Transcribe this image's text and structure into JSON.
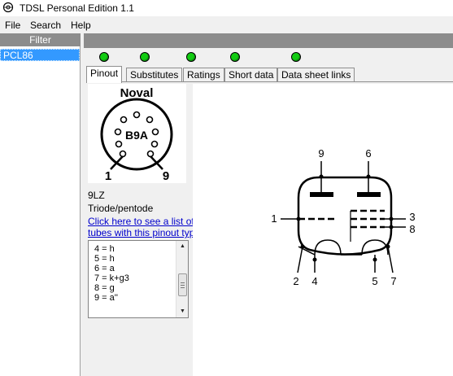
{
  "window": {
    "title": "TDSL Personal Edition 1.1"
  },
  "menu": {
    "items": [
      {
        "label": "File"
      },
      {
        "label": "Search"
      },
      {
        "label": "Help"
      }
    ]
  },
  "sidebar": {
    "filter_label": "Filter",
    "tubes": [
      {
        "label": "PCL86",
        "selected": true
      }
    ]
  },
  "indicators": {
    "count": 5,
    "color": "#12cc12"
  },
  "tabs": [
    {
      "label": "Pinout",
      "active": true
    },
    {
      "label": "Substitutes",
      "active": false
    },
    {
      "label": "Ratings",
      "active": false
    },
    {
      "label": "Short data",
      "active": false
    },
    {
      "label": "Data sheet links",
      "active": false
    }
  ],
  "socket": {
    "name": "Noval",
    "code": "B9A",
    "pin_left": "1",
    "pin_right": "9"
  },
  "pinout": {
    "code": "9LZ",
    "type": "Triode/pentode",
    "link_line1": "Click here to see a list of",
    "link_line2": "tubes with this pinout type",
    "pins": [
      "4 = h",
      "5 = h",
      "6 = a",
      "7 = k+g3",
      "8 = g",
      "9 = a''"
    ]
  },
  "schematic": {
    "labels": {
      "p1": "1",
      "p2": "2",
      "p3": "3",
      "p4": "4",
      "p5": "5",
      "p6": "6",
      "p7": "7",
      "p8": "8",
      "p9": "9"
    }
  }
}
